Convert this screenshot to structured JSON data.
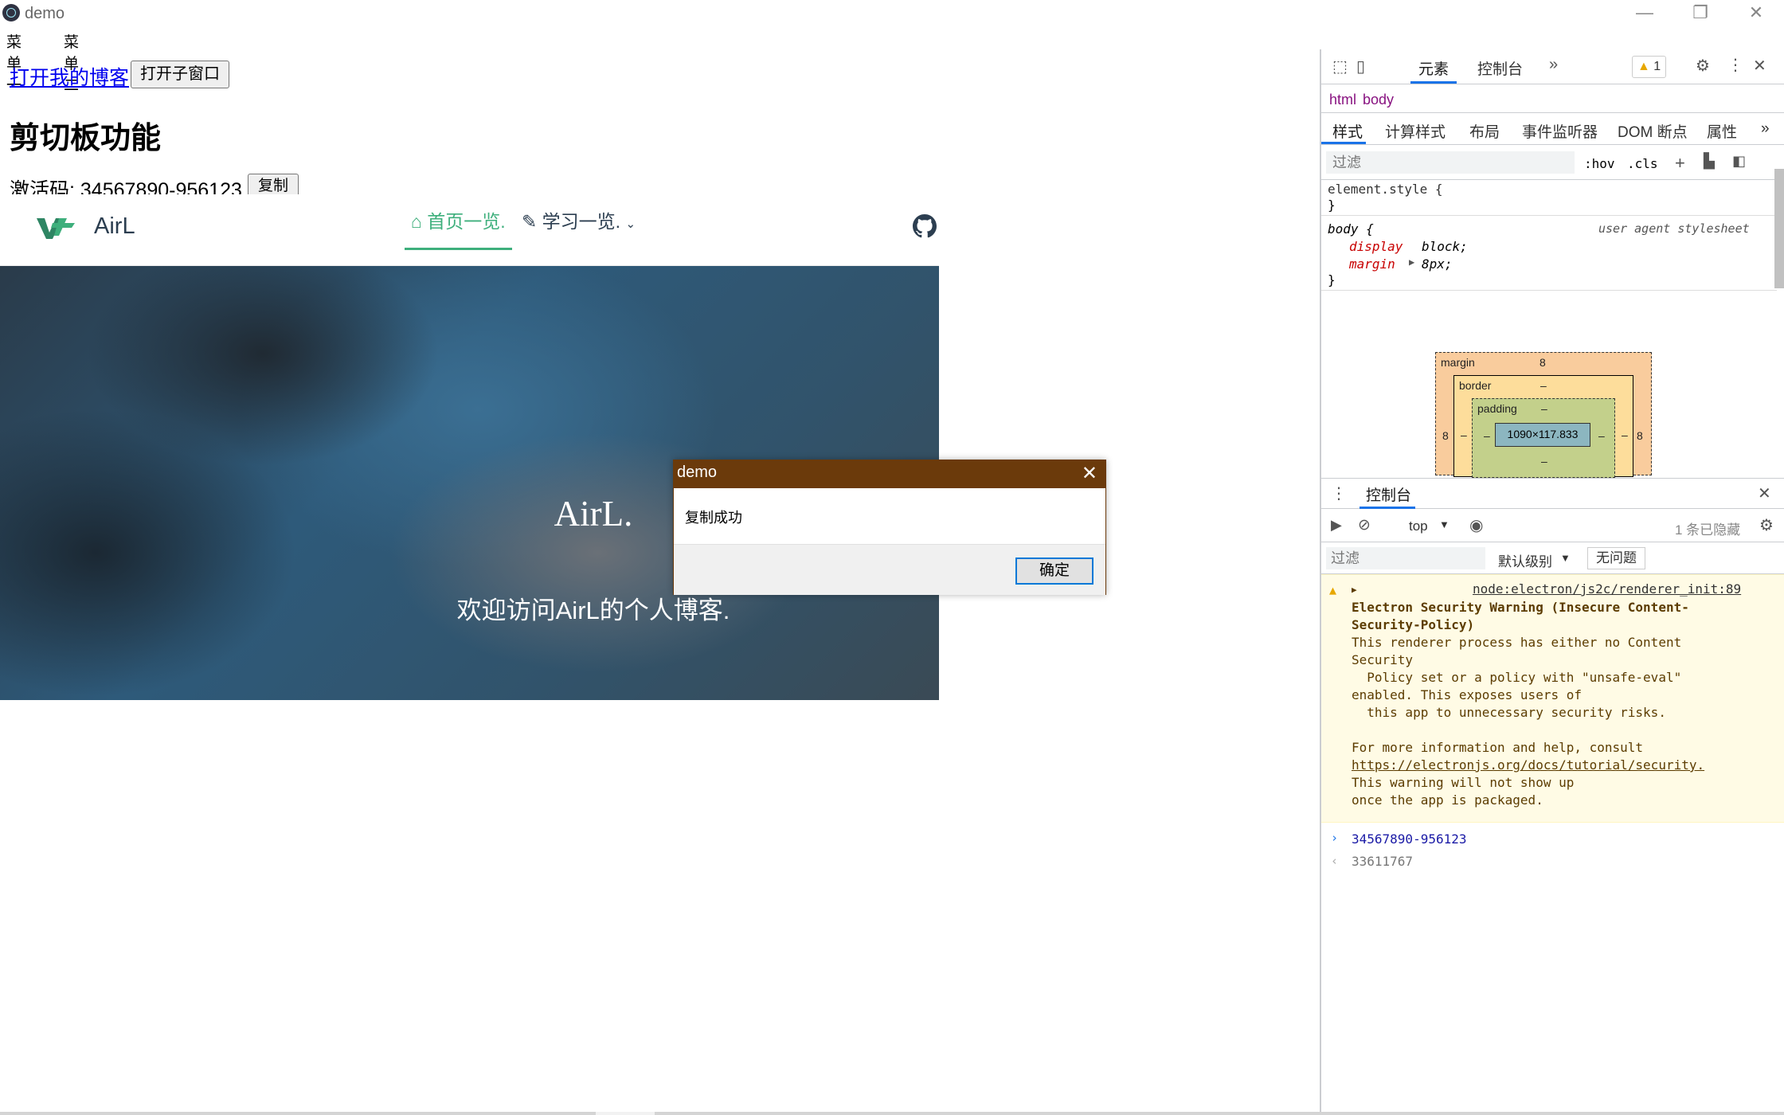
{
  "window": {
    "title": "demo",
    "minimize": "—",
    "restore": "❐",
    "close": "✕"
  },
  "menu": {
    "items": [
      "菜单一",
      "菜单二"
    ]
  },
  "page": {
    "blog_link": "打开我的博客",
    "open_child_button": "打开子窗口",
    "title": "剪切板功能",
    "code_label": "激活码: 34567890-956123",
    "copy_button": "复制"
  },
  "site": {
    "brand": "AirL",
    "nav": {
      "home": "首页一览.",
      "learn": "学习一览."
    },
    "hero_title": "AirL.",
    "hero_subtitle": "欢迎访问AirL的个人博客."
  },
  "dialog": {
    "title": "demo",
    "message": "复制成功",
    "ok": "确定"
  },
  "devtools": {
    "tabs": {
      "elements": "元素",
      "console": "控制台"
    },
    "warning_count": "1",
    "breadcrumb": [
      "html",
      "body"
    ],
    "subtabs": [
      "样式",
      "计算样式",
      "布局",
      "事件监听器",
      "DOM 断点",
      "属性"
    ],
    "filter_placeholder": "过滤",
    "hov": ":hov",
    "cls": ".cls",
    "styles": {
      "element_style": "element.style {",
      "close_brace": "}",
      "body_sel": "body {",
      "ua": "user agent stylesheet",
      "prop1_name": "display",
      "prop1_val": "block;",
      "prop2_name": "margin",
      "prop2_val": "8px;"
    },
    "box_model": {
      "margin_label": "margin",
      "border_label": "border",
      "padding_label": "padding",
      "margin_top": "8",
      "margin_left": "8",
      "margin_right": "8",
      "border_top": "–",
      "border_left": "–",
      "border_right": "–",
      "padding_top": "–",
      "padding_left": "–",
      "padding_right": "–",
      "padding_bottom": "–",
      "content": "1090×117.833"
    },
    "drawer": {
      "title": "控制台",
      "context": "top",
      "hidden_count": "1 条已隐藏",
      "filter_placeholder": "过滤",
      "level": "默认级别",
      "issues": "无问题",
      "warning": {
        "source": "node:electron/js2c/renderer_init:89",
        "lines": [
          "Electron Security Warning (Insecure Content-",
          "Security-Policy)",
          "This renderer process has either no Content",
          "Security",
          "  Policy set or a policy with \"unsafe-eval\"",
          "enabled. This exposes users of",
          "  this app to unnecessary security risks.",
          "",
          "For more information and help, consult",
          "https://electronjs.org/docs/tutorial/security.",
          "This warning will not show up",
          "once the app is packaged."
        ]
      },
      "input": "34567890-956123",
      "result": "33611767"
    }
  },
  "colors": {
    "accent": "#3eaf7c",
    "dialog_bar": "#6b3a0b",
    "devtools_blue": "#1a73e8"
  }
}
